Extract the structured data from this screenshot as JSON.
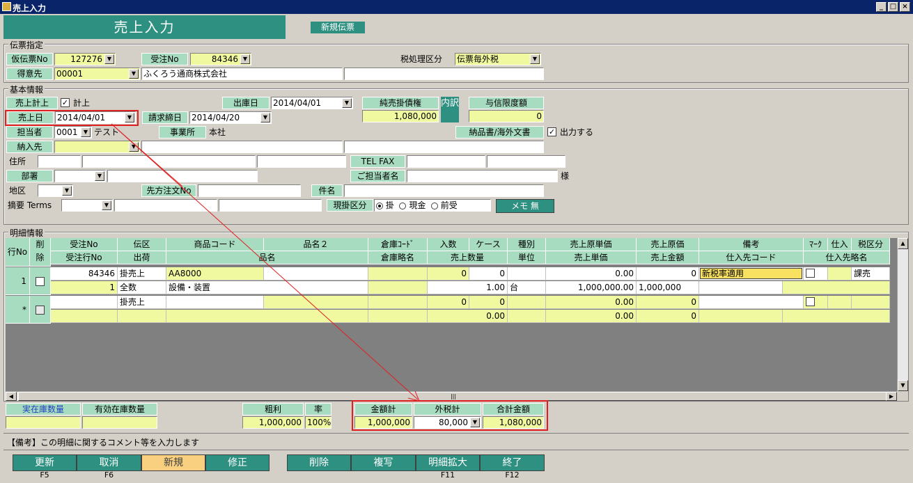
{
  "window": {
    "title": "売上入力"
  },
  "header": {
    "title": "売上入力",
    "new_badge": "新規伝票"
  },
  "voucher": {
    "group_label": "伝票指定",
    "temp_no_label": "仮伝票No",
    "temp_no": "127276",
    "order_no_label": "受注No",
    "order_no": "84346",
    "tax_label": "税処理区分",
    "tax_value": "伝票毎外税",
    "customer_label": "得意先",
    "customer_code": "00001",
    "customer_name": "ふくろう通商株式会社"
  },
  "basic": {
    "group_label": "基本情報",
    "sales_post_label": "売上計上",
    "sales_post_check": "計上",
    "ship_date_label": "出庫日",
    "ship_date": "2014/04/01",
    "net_ar_label": "純売掛債権",
    "net_ar": "1,080,000",
    "breakdown_btn": "内訳",
    "credit_label": "与信限度額",
    "credit": "0",
    "sales_date_label": "売上日",
    "sales_date": "2014/04/01",
    "bill_date_label": "請求締日",
    "bill_date": "2014/04/20",
    "staff_label": "担当者",
    "staff_code": "0001",
    "staff_name": "テスト",
    "office_label": "事業所",
    "office": "本社",
    "doc_label": "納品書/海外文書",
    "doc_check": "出力する",
    "delivery_label": "納入先",
    "address_label": "住所",
    "telfax_label": "TEL FAX",
    "dept_label": "部署",
    "contact_label": "ご担当者名",
    "contact_suffix": "様",
    "region_label": "地区",
    "po_label": "先方注文No",
    "subject_label": "件名",
    "summary_label": "摘要 Terms",
    "payment_label": "現掛区分",
    "pay_options": [
      "掛",
      "現金",
      "前受"
    ],
    "memo_btn": "メモ 無"
  },
  "detail": {
    "group_label": "明細情報",
    "headers_top": [
      "行No",
      "削除",
      "受注No",
      "伝区",
      "商品コード",
      "品名２",
      "倉庫ｺｰﾄﾞ",
      "入数",
      "ケース",
      "種別",
      "売上原単価",
      "売上原価",
      "備考",
      "ﾏｰｸ",
      "仕入",
      "税区分"
    ],
    "headers_bottom": [
      "受注行No",
      "出荷",
      "品名",
      "倉庫略名",
      "売上数量",
      "単位",
      "売上単価",
      "売上金額",
      "仕入先コード",
      "仕入先略名"
    ],
    "rows": [
      {
        "row_no": "1",
        "order_no": "84346",
        "slip_type": "掛売上",
        "product_code": "AA8000",
        "pack": "0",
        "case": "0",
        "cost_unit": "0.00",
        "cost": "0",
        "remark": "新税率適用",
        "tax_class": "課売",
        "order_line": "1",
        "shipping": "全数",
        "product_name": "設備・装置",
        "qty": "1.00",
        "unit": "台",
        "unit_price": "1,000,000.00",
        "amount": "1,000,000"
      },
      {
        "row_no": "*",
        "order_no": "",
        "slip_type": "掛売上",
        "product_code": "",
        "pack": "0",
        "case": "0",
        "cost_unit": "0.00",
        "cost": "0",
        "remark": "",
        "tax_class": "",
        "order_line": "",
        "shipping": "",
        "product_name": "",
        "qty": "0.00",
        "unit": "",
        "unit_price": "0.00",
        "amount": "0"
      }
    ]
  },
  "totals": {
    "actual_stock_label": "実在庫数量",
    "valid_stock_label": "有効在庫数量",
    "gross_label": "粗利",
    "gross": "1,000,000",
    "rate_label": "率",
    "rate": "100%",
    "amount_label": "金額計",
    "amount": "1,000,000",
    "tax_label": "外税計",
    "tax": "80,000",
    "total_label": "合計金額",
    "total": "1,080,000"
  },
  "status": "【備考】この明細に関するコメント等を入力します",
  "fbuttons": [
    {
      "label": "更新",
      "key": "F5"
    },
    {
      "label": "取消",
      "key": "F6"
    },
    {
      "label": "新規",
      "key": ""
    },
    {
      "label": "修正",
      "key": ""
    },
    {
      "label": "削除",
      "key": ""
    },
    {
      "label": "複写",
      "key": ""
    },
    {
      "label": "明細拡大",
      "key": "F11"
    },
    {
      "label": "終了",
      "key": "F12"
    }
  ]
}
